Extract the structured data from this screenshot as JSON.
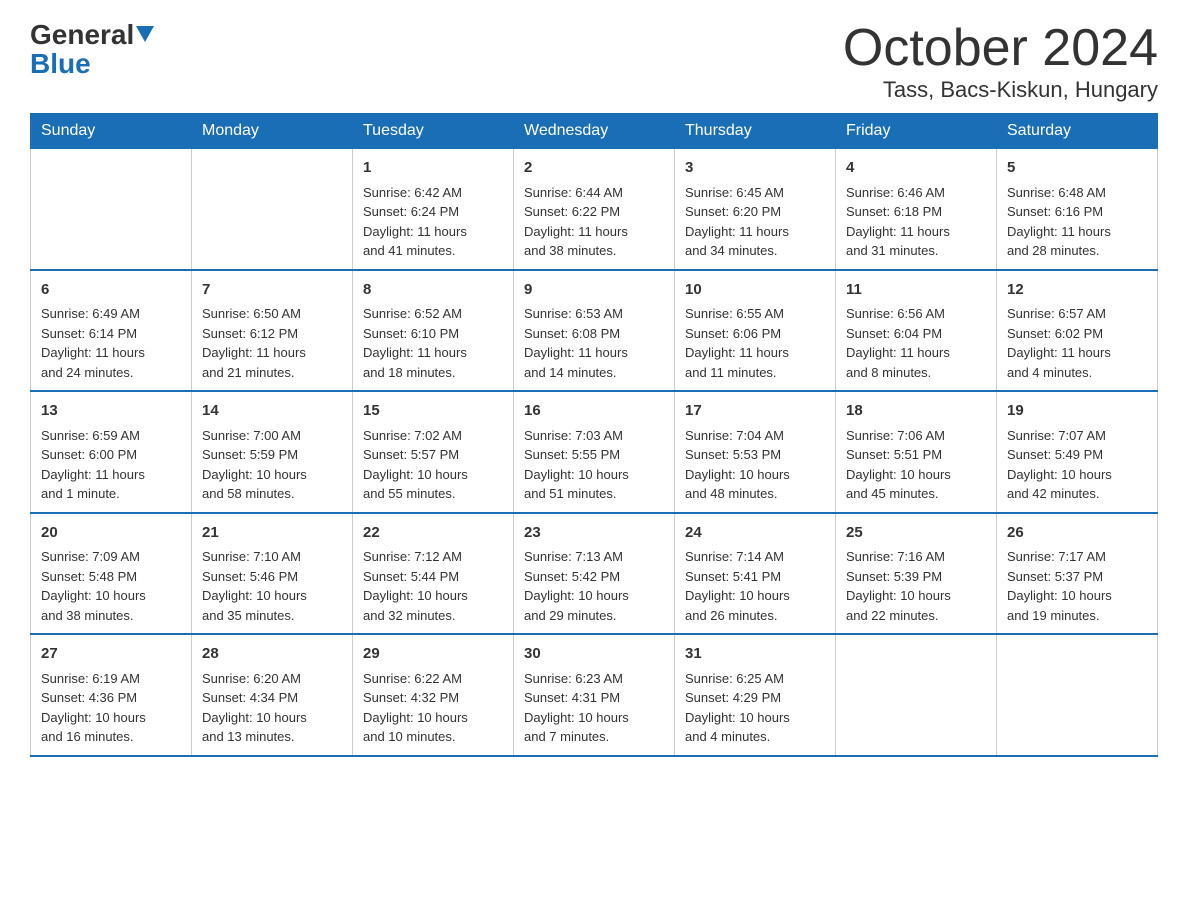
{
  "logo": {
    "general": "General",
    "blue": "Blue"
  },
  "title": "October 2024",
  "subtitle": "Tass, Bacs-Kiskun, Hungary",
  "calendar": {
    "headers": [
      "Sunday",
      "Monday",
      "Tuesday",
      "Wednesday",
      "Thursday",
      "Friday",
      "Saturday"
    ],
    "weeks": [
      [
        {
          "day": "",
          "info": ""
        },
        {
          "day": "",
          "info": ""
        },
        {
          "day": "1",
          "info": "Sunrise: 6:42 AM\nSunset: 6:24 PM\nDaylight: 11 hours\nand 41 minutes."
        },
        {
          "day": "2",
          "info": "Sunrise: 6:44 AM\nSunset: 6:22 PM\nDaylight: 11 hours\nand 38 minutes."
        },
        {
          "day": "3",
          "info": "Sunrise: 6:45 AM\nSunset: 6:20 PM\nDaylight: 11 hours\nand 34 minutes."
        },
        {
          "day": "4",
          "info": "Sunrise: 6:46 AM\nSunset: 6:18 PM\nDaylight: 11 hours\nand 31 minutes."
        },
        {
          "day": "5",
          "info": "Sunrise: 6:48 AM\nSunset: 6:16 PM\nDaylight: 11 hours\nand 28 minutes."
        }
      ],
      [
        {
          "day": "6",
          "info": "Sunrise: 6:49 AM\nSunset: 6:14 PM\nDaylight: 11 hours\nand 24 minutes."
        },
        {
          "day": "7",
          "info": "Sunrise: 6:50 AM\nSunset: 6:12 PM\nDaylight: 11 hours\nand 21 minutes."
        },
        {
          "day": "8",
          "info": "Sunrise: 6:52 AM\nSunset: 6:10 PM\nDaylight: 11 hours\nand 18 minutes."
        },
        {
          "day": "9",
          "info": "Sunrise: 6:53 AM\nSunset: 6:08 PM\nDaylight: 11 hours\nand 14 minutes."
        },
        {
          "day": "10",
          "info": "Sunrise: 6:55 AM\nSunset: 6:06 PM\nDaylight: 11 hours\nand 11 minutes."
        },
        {
          "day": "11",
          "info": "Sunrise: 6:56 AM\nSunset: 6:04 PM\nDaylight: 11 hours\nand 8 minutes."
        },
        {
          "day": "12",
          "info": "Sunrise: 6:57 AM\nSunset: 6:02 PM\nDaylight: 11 hours\nand 4 minutes."
        }
      ],
      [
        {
          "day": "13",
          "info": "Sunrise: 6:59 AM\nSunset: 6:00 PM\nDaylight: 11 hours\nand 1 minute."
        },
        {
          "day": "14",
          "info": "Sunrise: 7:00 AM\nSunset: 5:59 PM\nDaylight: 10 hours\nand 58 minutes."
        },
        {
          "day": "15",
          "info": "Sunrise: 7:02 AM\nSunset: 5:57 PM\nDaylight: 10 hours\nand 55 minutes."
        },
        {
          "day": "16",
          "info": "Sunrise: 7:03 AM\nSunset: 5:55 PM\nDaylight: 10 hours\nand 51 minutes."
        },
        {
          "day": "17",
          "info": "Sunrise: 7:04 AM\nSunset: 5:53 PM\nDaylight: 10 hours\nand 48 minutes."
        },
        {
          "day": "18",
          "info": "Sunrise: 7:06 AM\nSunset: 5:51 PM\nDaylight: 10 hours\nand 45 minutes."
        },
        {
          "day": "19",
          "info": "Sunrise: 7:07 AM\nSunset: 5:49 PM\nDaylight: 10 hours\nand 42 minutes."
        }
      ],
      [
        {
          "day": "20",
          "info": "Sunrise: 7:09 AM\nSunset: 5:48 PM\nDaylight: 10 hours\nand 38 minutes."
        },
        {
          "day": "21",
          "info": "Sunrise: 7:10 AM\nSunset: 5:46 PM\nDaylight: 10 hours\nand 35 minutes."
        },
        {
          "day": "22",
          "info": "Sunrise: 7:12 AM\nSunset: 5:44 PM\nDaylight: 10 hours\nand 32 minutes."
        },
        {
          "day": "23",
          "info": "Sunrise: 7:13 AM\nSunset: 5:42 PM\nDaylight: 10 hours\nand 29 minutes."
        },
        {
          "day": "24",
          "info": "Sunrise: 7:14 AM\nSunset: 5:41 PM\nDaylight: 10 hours\nand 26 minutes."
        },
        {
          "day": "25",
          "info": "Sunrise: 7:16 AM\nSunset: 5:39 PM\nDaylight: 10 hours\nand 22 minutes."
        },
        {
          "day": "26",
          "info": "Sunrise: 7:17 AM\nSunset: 5:37 PM\nDaylight: 10 hours\nand 19 minutes."
        }
      ],
      [
        {
          "day": "27",
          "info": "Sunrise: 6:19 AM\nSunset: 4:36 PM\nDaylight: 10 hours\nand 16 minutes."
        },
        {
          "day": "28",
          "info": "Sunrise: 6:20 AM\nSunset: 4:34 PM\nDaylight: 10 hours\nand 13 minutes."
        },
        {
          "day": "29",
          "info": "Sunrise: 6:22 AM\nSunset: 4:32 PM\nDaylight: 10 hours\nand 10 minutes."
        },
        {
          "day": "30",
          "info": "Sunrise: 6:23 AM\nSunset: 4:31 PM\nDaylight: 10 hours\nand 7 minutes."
        },
        {
          "day": "31",
          "info": "Sunrise: 6:25 AM\nSunset: 4:29 PM\nDaylight: 10 hours\nand 4 minutes."
        },
        {
          "day": "",
          "info": ""
        },
        {
          "day": "",
          "info": ""
        }
      ]
    ]
  }
}
